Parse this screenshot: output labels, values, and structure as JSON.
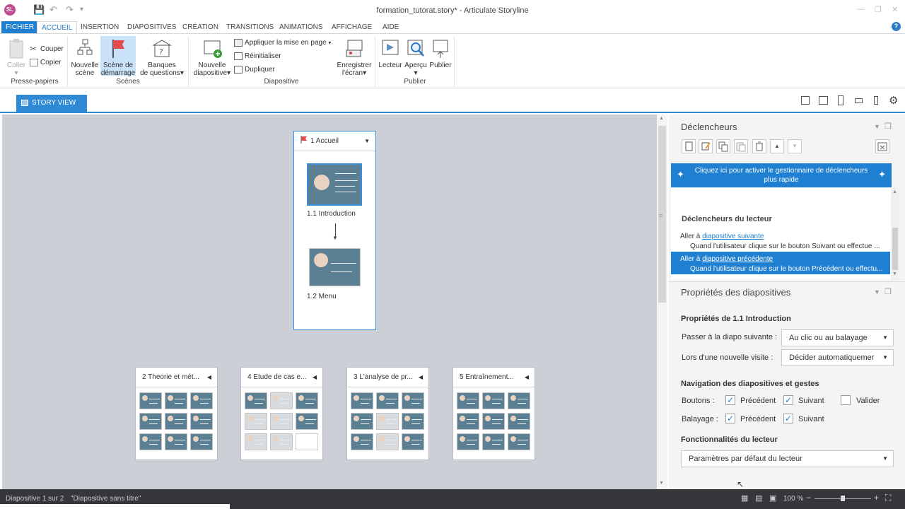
{
  "app": {
    "avatar": "SL",
    "title": "formation_tutorat.story* - Articulate Storyline",
    "undo_icon": "undo-icon",
    "redo_icon": "redo-icon"
  },
  "menu": {
    "tabs": [
      "FICHIER",
      "ACCUEIL",
      "INSERTION",
      "DIAPOSITIVES",
      "CRÉATION",
      "TRANSITIONS",
      "ANIMATIONS",
      "AFFICHAGE",
      "AIDE"
    ],
    "active": "ACCUEIL"
  },
  "ribbon": {
    "clipboard": {
      "paste": "Coller",
      "cut": "Couper",
      "copy": "Copier",
      "group": "Presse-papiers"
    },
    "scenes": {
      "new_scene": [
        "Nouvelle",
        "scène"
      ],
      "start_scene": [
        "Scène de",
        "démarrage"
      ],
      "question_banks": [
        "Banques",
        "de questions"
      ],
      "group": "Scènes"
    },
    "slide": {
      "new_slide": [
        "Nouvelle",
        "diapositive"
      ],
      "apply_layout": "Appliquer la mise en page",
      "reset": "Réinitialiser",
      "duplicate": "Dupliquer",
      "group": "Diapositive"
    },
    "record": [
      "Enregistrer",
      "l'écran"
    ],
    "publish": {
      "player": "Lecteur",
      "preview": "Aperçu",
      "publish": "Publier",
      "group": "Publier"
    }
  },
  "view": {
    "story_tab": "STORY VIEW"
  },
  "canvas": {
    "start_scene": {
      "title": "1 Accueil",
      "slides": [
        "1.1 Introduction",
        "1.2 Menu"
      ]
    },
    "scenes": [
      {
        "title": "2 Theorie et mét...",
        "count": 9
      },
      {
        "title": "4 Etude de cas e...",
        "count": 9
      },
      {
        "title": "3 L'analyse de pr...",
        "count": 9
      },
      {
        "title": "5 Entraînement...",
        "count": 9
      }
    ]
  },
  "triggers": {
    "title": "Déclencheurs",
    "banner": "Cliquez ici pour activer le gestionnaire de déclencheurs plus rapide",
    "section": "Déclencheurs du lecteur",
    "items": [
      {
        "action": "Aller à",
        "target": "diapositive suivante",
        "condition": "Quand l'utilisateur clique sur le bouton Suivant ou effectue ..."
      },
      {
        "action": "Aller à",
        "target": "diapositive précédente",
        "condition": "Quand l'utilisateur clique sur le bouton Précédent ou effectu..."
      }
    ]
  },
  "props": {
    "title": "Propriétés des diapositives",
    "heading": "Propriétés de 1.1 Introduction",
    "advance_label": "Passer à la diapo suivante :",
    "advance_value": "Au clic ou au balayage",
    "revisit_label": "Lors d'une nouvelle visite :",
    "revisit_value": "Décider automatiquemer",
    "nav_heading": "Navigation des diapositives et gestes",
    "buttons_label": "Boutons :",
    "swipe_label": "Balayage :",
    "prev": "Précédent",
    "next": "Suivant",
    "submit": "Valider",
    "player_heading": "Fonctionnalités du lecteur",
    "player_value": "Paramètres par défaut du lecteur"
  },
  "status": {
    "slide": "Diapositive 1 sur 2",
    "slide_title": "\"Diapositive sans titre\"",
    "zoom": "100 %"
  }
}
